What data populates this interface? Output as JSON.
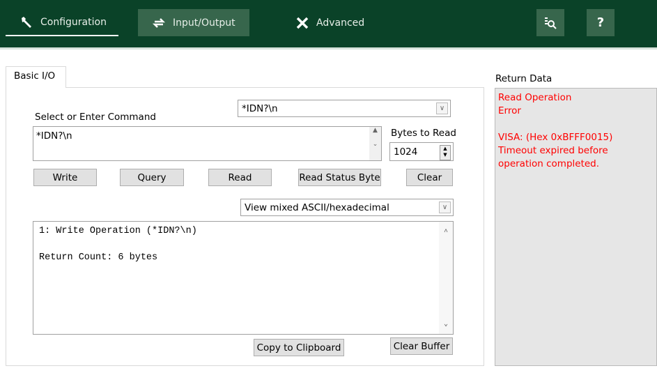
{
  "nav": {
    "configuration": "Configuration",
    "input_output": "Input/Output",
    "advanced": "Advanced",
    "help": "?"
  },
  "tabs": [
    {
      "label": "Basic I/O"
    }
  ],
  "command": {
    "dropdown_value": "*IDN?\\n",
    "label": "Select or Enter Command",
    "text": "*IDN?\\n"
  },
  "bytes": {
    "label": "Bytes to Read",
    "value": "1024"
  },
  "buttons": {
    "write": "Write",
    "query": "Query",
    "read": "Read",
    "read_status_byte": "Read Status Byte",
    "clear": "Clear",
    "copy": "Copy to Clipboard",
    "clear_buffer": "Clear Buffer"
  },
  "view": {
    "value": "View mixed ASCII/hexadecimal"
  },
  "output": {
    "lines": [
      "1: Write Operation (*IDN?\\n)",
      "",
      "Return Count: 6 bytes"
    ]
  },
  "return_data": {
    "label": "Return Data",
    "lines": [
      "Read Operation",
      "Error",
      "",
      "VISA:  (Hex 0xBFFF0015) Timeout expired before operation completed."
    ]
  },
  "colors": {
    "header": "#0a4228",
    "error_text": "#ff0000"
  }
}
